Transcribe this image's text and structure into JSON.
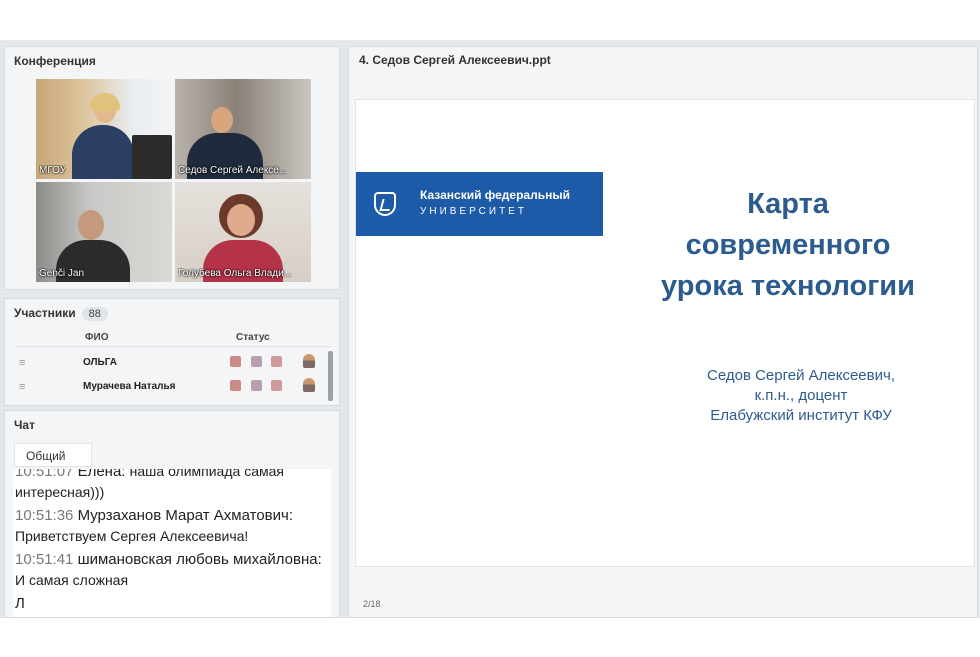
{
  "conference": {
    "title": "Конференция",
    "tiles": [
      {
        "label": "МГОУ"
      },
      {
        "label": "Седов Сергей Алексе..."
      },
      {
        "label": "Genči Jan"
      },
      {
        "label": "Голубева Ольга Влади..."
      }
    ]
  },
  "participants": {
    "title": "Участники",
    "count": "88",
    "columns": {
      "name": "ФИО",
      "status": "Статус"
    },
    "rows": [
      {
        "name": "ОЛЬГА"
      },
      {
        "name": "Мурачева Наталья"
      }
    ]
  },
  "chat": {
    "title": "Чат",
    "tab": "Общий",
    "messages": [
      {
        "time": "10:51:07",
        "author": "Елена:",
        "text": "наша олимпиада самая интересная)))"
      },
      {
        "time": "10:51:36",
        "author": "Мурзаханов Марат Ахматович:",
        "text": "Приветствуем Сергея Алексеевича!"
      },
      {
        "time": "10:51:41",
        "author": "шимановская любовь михайловна:",
        "text": "И самая сложная"
      },
      {
        "time": "",
        "author": "Л",
        "text": ""
      }
    ]
  },
  "presentation": {
    "filename": "4. Седов Сергей Алексеевич.ppt",
    "logo": {
      "line1": "Казанский федеральный",
      "line2": "УНИВЕРСИТЕТ"
    },
    "title_lines": [
      "Карта",
      "современного",
      "урока технологии"
    ],
    "author_lines": [
      "Седов Сергей Алексеевич,",
      "к.п.н., доцент",
      "Елабужский институт КФУ"
    ],
    "pager": "2/18"
  },
  "colors": {
    "brand_blue": "#1d5aa8",
    "slide_text": "#2c5c8f"
  }
}
